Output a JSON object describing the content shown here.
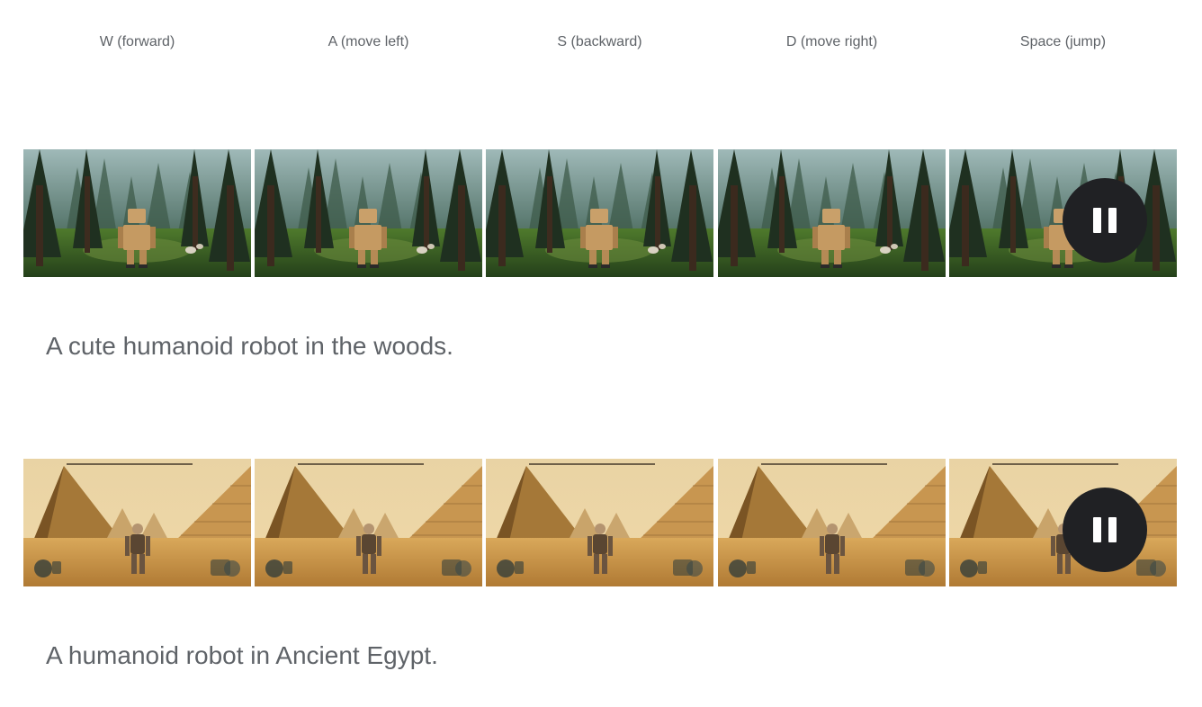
{
  "key_labels": [
    "W (forward)",
    "A (move left)",
    "S (backward)",
    "D (move right)",
    "Space (jump)"
  ],
  "rows": [
    {
      "caption": "A cute humanoid robot in the woods.",
      "scene": "forest-robot",
      "control": "pause"
    },
    {
      "caption": "A humanoid robot in Ancient Egypt.",
      "scene": "egypt-robot",
      "control": "pause"
    }
  ],
  "colors": {
    "text": "#5f6368",
    "pause_button_bg": "#202124",
    "pause_icon": "#ffffff"
  }
}
